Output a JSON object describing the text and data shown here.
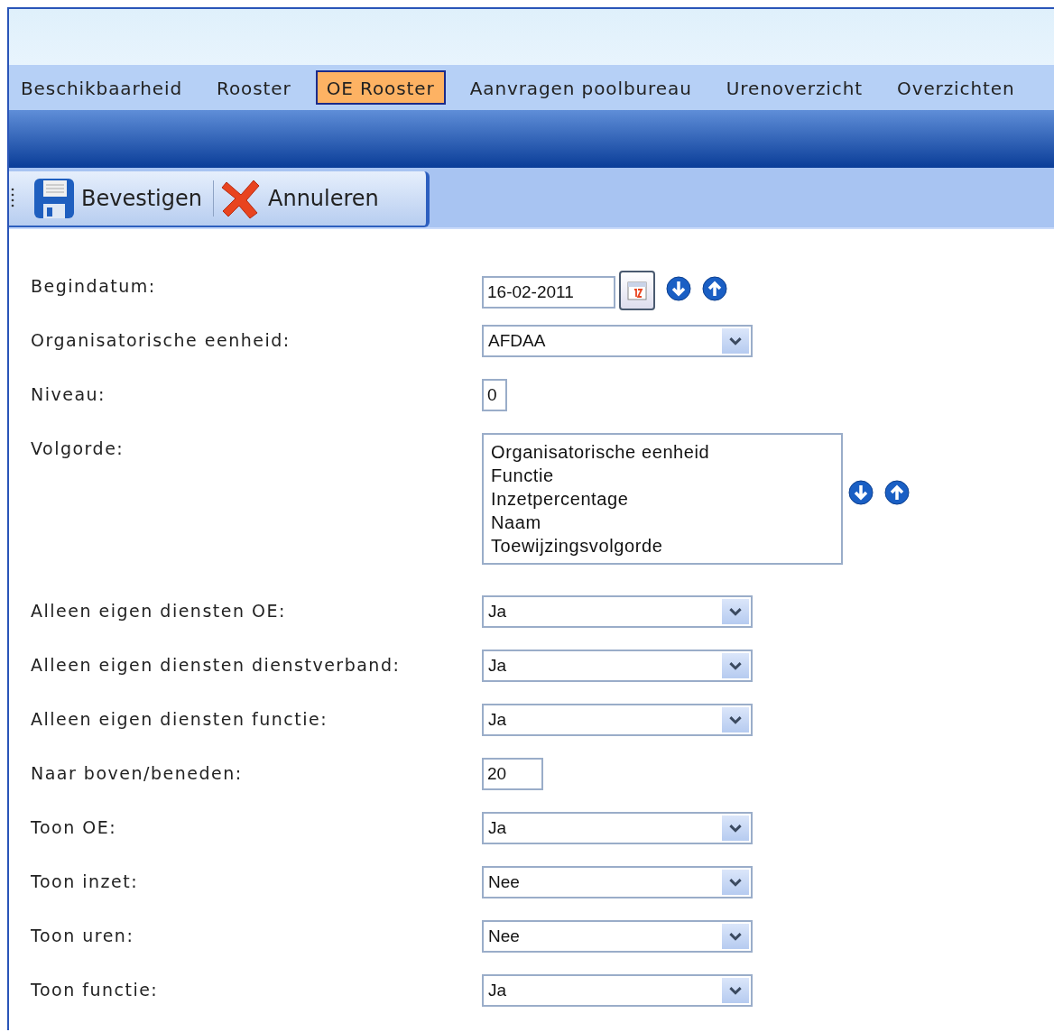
{
  "tabs": [
    {
      "label": "Beschikbaarheid",
      "selected": false
    },
    {
      "label": "Rooster",
      "selected": false
    },
    {
      "label": "OE Rooster",
      "selected": true
    },
    {
      "label": "Aanvragen poolbureau",
      "selected": false
    },
    {
      "label": "Urenoverzicht",
      "selected": false
    },
    {
      "label": "Overzichten",
      "selected": false
    }
  ],
  "toolbar": [
    {
      "kind": "save",
      "label": "Bevestigen"
    },
    {
      "kind": "cancel",
      "label": "Annuleren"
    }
  ],
  "fields": [
    {
      "kind": "date",
      "label": "Begindatum:",
      "value": "16-02-2011"
    },
    {
      "kind": "select",
      "label": "Organisatorische eenheid:",
      "value": "AFDAA"
    },
    {
      "kind": "text",
      "label": "Niveau:",
      "value": "0"
    },
    {
      "kind": "list",
      "label": "Volgorde:",
      "items": [
        "Organisatorische eenheid",
        "Functie",
        "Inzetpercentage",
        "Naam",
        "Toewijzingsvolgorde"
      ]
    },
    {
      "kind": "select",
      "label": "Alleen eigen diensten OE:",
      "value": "Ja"
    },
    {
      "kind": "select",
      "label": "Alleen eigen diensten dienstverband:",
      "value": "Ja"
    },
    {
      "kind": "select",
      "label": "Alleen eigen diensten functie:",
      "value": "Ja"
    },
    {
      "kind": "text",
      "label": "Naar boven/beneden:",
      "value": "20"
    },
    {
      "kind": "select",
      "label": "Toon OE:",
      "value": "Ja"
    },
    {
      "kind": "select",
      "label": "Toon inzet:",
      "value": "Nee"
    },
    {
      "kind": "select",
      "label": "Toon uren:",
      "value": "Nee"
    },
    {
      "kind": "select",
      "label": "Toon functie:",
      "value": "Ja"
    }
  ]
}
